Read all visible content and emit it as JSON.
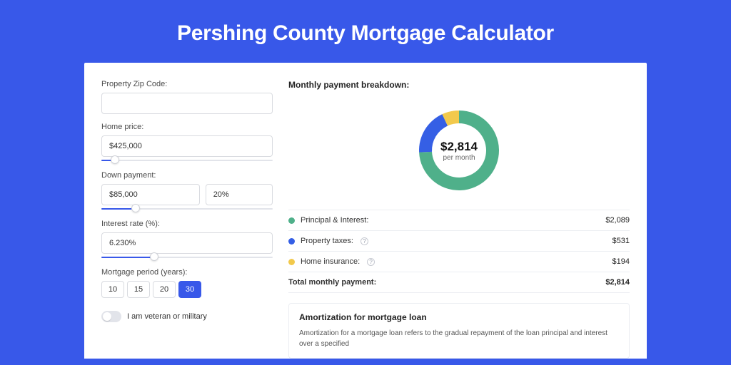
{
  "hero": {
    "title": "Pershing County Mortgage Calculator"
  },
  "colors": {
    "green": "#4fb08a",
    "blue": "#355fe5",
    "yellow": "#f2c94c"
  },
  "form": {
    "zip": {
      "label": "Property Zip Code:",
      "value": ""
    },
    "home_price": {
      "label": "Home price:",
      "value": "$425,000",
      "slider_pct": 8
    },
    "down_payment": {
      "label": "Down payment:",
      "value": "$85,000",
      "pct_value": "20%",
      "slider_pct": 20
    },
    "interest_rate": {
      "label": "Interest rate (%):",
      "value": "6.230%",
      "slider_pct": 31
    },
    "mortgage_period": {
      "label": "Mortgage period (years):",
      "options": [
        "10",
        "15",
        "20",
        "30"
      ],
      "selected_index": 3
    },
    "veteran": {
      "label": "I am veteran or military",
      "on": false
    }
  },
  "breakdown": {
    "title": "Monthly payment breakdown:",
    "center_amount": "$2,814",
    "center_sub": "per month",
    "items": [
      {
        "swatch": "green",
        "label": "Principal & Interest:",
        "info": false,
        "value": "$2,089"
      },
      {
        "swatch": "blue",
        "label": "Property taxes:",
        "info": true,
        "value": "$531"
      },
      {
        "swatch": "yellow",
        "label": "Home insurance:",
        "info": true,
        "value": "$194"
      }
    ],
    "total": {
      "label": "Total monthly payment:",
      "value": "$2,814"
    }
  },
  "chart_data": {
    "type": "pie",
    "title": "Monthly payment breakdown",
    "series": [
      {
        "name": "Principal & Interest",
        "value": 2089,
        "color": "#4fb08a"
      },
      {
        "name": "Property taxes",
        "value": 531,
        "color": "#355fe5"
      },
      {
        "name": "Home insurance",
        "value": 194,
        "color": "#f2c94c"
      }
    ],
    "center_label": "$2,814 per month",
    "total": 2814
  },
  "amort": {
    "title": "Amortization for mortgage loan",
    "text": "Amortization for a mortgage loan refers to the gradual repayment of the loan principal and interest over a specified"
  }
}
